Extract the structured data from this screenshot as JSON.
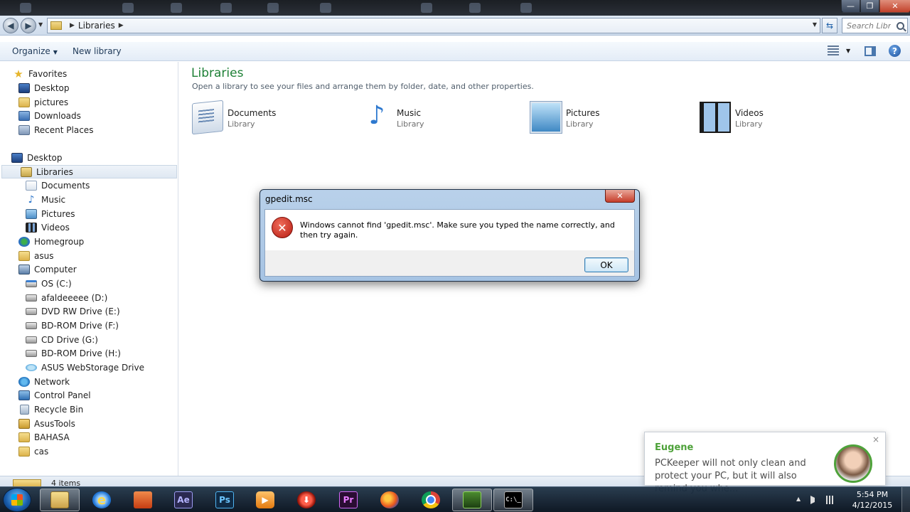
{
  "window": {
    "min_glyph": "—",
    "max_glyph": "❐",
    "close_glyph": "✕"
  },
  "address": {
    "path": [
      "Libraries"
    ],
    "search_placeholder": "Search Libr..."
  },
  "toolbar": {
    "organize_label": "Organize",
    "new_library_label": "New library"
  },
  "nav": {
    "favorites_header": "Favorites",
    "favorites": [
      {
        "label": "Desktop",
        "icon": "desktop-icon"
      },
      {
        "label": "pictures",
        "icon": "folder-icon"
      },
      {
        "label": "Downloads",
        "icon": "downloads-icon"
      },
      {
        "label": "Recent Places",
        "icon": "recent-places-icon"
      }
    ],
    "desktop_header": "Desktop",
    "libraries_label": "Libraries",
    "library_children": [
      {
        "label": "Documents",
        "icon": "documents-icon"
      },
      {
        "label": "Music",
        "icon": "music-icon"
      },
      {
        "label": "Pictures",
        "icon": "pictures-icon"
      },
      {
        "label": "Videos",
        "icon": "videos-icon"
      }
    ],
    "homegroup_label": "Homegroup",
    "asus_label": "asus",
    "computer_label": "Computer",
    "drives": [
      {
        "label": "OS (C:)",
        "icon": "os-drive-icon"
      },
      {
        "label": "afaldeeeee (D:)",
        "icon": "drive-icon"
      },
      {
        "label": "DVD RW Drive (E:)",
        "icon": "dvd-drive-icon"
      },
      {
        "label": "BD-ROM Drive (F:)",
        "icon": "bd-drive-icon"
      },
      {
        "label": "CD Drive (G:)",
        "icon": "cd-drive-icon"
      },
      {
        "label": "BD-ROM Drive (H:)",
        "icon": "bd-drive-icon"
      },
      {
        "label": "ASUS WebStorage Drive",
        "icon": "cloud-drive-icon"
      }
    ],
    "root_items": [
      {
        "label": "Network",
        "icon": "network-icon"
      },
      {
        "label": "Control Panel",
        "icon": "control-panel-icon"
      },
      {
        "label": "Recycle Bin",
        "icon": "recycle-bin-icon"
      },
      {
        "label": "AsusTools",
        "icon": "folder-icon"
      },
      {
        "label": "BAHASA",
        "icon": "folder-icon"
      },
      {
        "label": "cas",
        "icon": "folder-icon"
      }
    ]
  },
  "content": {
    "title": "Libraries",
    "subtitle": "Open a library to see your files and arrange them by folder, date, and other properties.",
    "libraries": [
      {
        "name": "Documents",
        "kind": "Library"
      },
      {
        "name": "Music",
        "kind": "Library"
      },
      {
        "name": "Pictures",
        "kind": "Library"
      },
      {
        "name": "Videos",
        "kind": "Library"
      }
    ]
  },
  "dialog": {
    "title": "gpedit.msc",
    "message": "Windows cannot find 'gpedit.msc'. Make sure you typed the name correctly, and then try again.",
    "ok_label": "OK",
    "close_glyph": "✕"
  },
  "status": {
    "items_text": "4 items"
  },
  "notification": {
    "name": "Eugene",
    "text": "PCKeeper will not only clean and protect your PC, but it will also remind you whe...",
    "close_glyph": "×"
  },
  "taskbar": {
    "apps": [
      {
        "name": "windows-explorer",
        "glyph": "",
        "active": true
      },
      {
        "name": "internet-explorer",
        "glyph": "e",
        "active": false
      },
      {
        "name": "paint",
        "glyph": "",
        "active": false
      },
      {
        "name": "after-effects",
        "glyph": "Ae",
        "active": false
      },
      {
        "name": "photoshop",
        "glyph": "Ps",
        "active": false
      },
      {
        "name": "media-player",
        "glyph": "▶",
        "active": false
      },
      {
        "name": "downloader",
        "glyph": "⬇",
        "active": false
      },
      {
        "name": "premiere",
        "glyph": "Pr",
        "active": false
      },
      {
        "name": "firefox",
        "glyph": "",
        "active": false
      },
      {
        "name": "chrome",
        "glyph": "",
        "active": false
      },
      {
        "name": "game-app",
        "glyph": "",
        "active": true
      },
      {
        "name": "command-prompt",
        "glyph": "C:\\_",
        "active": true
      }
    ],
    "time": "5:54 PM",
    "date": "4/12/2015"
  }
}
